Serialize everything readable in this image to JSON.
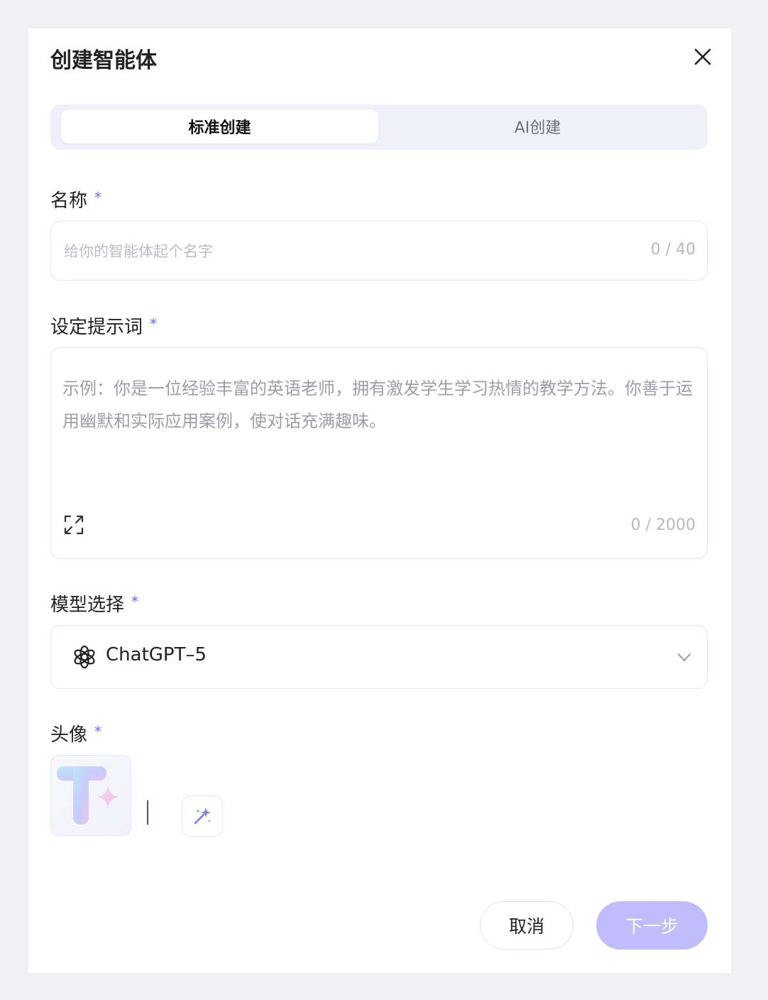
{
  "dialog": {
    "title": "创建智能体",
    "close_icon": "close-icon"
  },
  "tabs": [
    {
      "label": "标准创建",
      "active": true
    },
    {
      "label": "AI创建",
      "active": false
    }
  ],
  "name": {
    "label": "名称",
    "required_mark": "*",
    "placeholder": "给你的智能体起个名字",
    "value": "",
    "counter": "0 / 40"
  },
  "prompt": {
    "label": "设定提示词",
    "required_mark": "*",
    "placeholder": "示例：你是一位经验丰富的英语老师，拥有激发学生学习热情的教学方法。你善于运用幽默和实际应用案例，使对话充满趣味。",
    "value": "",
    "counter": "0 / 2000",
    "expand_icon": "expand-icon"
  },
  "model": {
    "label": "模型选择",
    "required_mark": "*",
    "selected": "ChatGPT–5",
    "icon": "openai-icon",
    "dropdown_icon": "chevron-down-icon"
  },
  "avatar": {
    "label": "头像",
    "required_mark": "*",
    "generate_icon": "magic-wand-icon"
  },
  "footer": {
    "cancel_label": "取消",
    "next_label": "下一步"
  },
  "colors": {
    "accent": "#6f69f2",
    "next_button_disabled": "#c1bcfb",
    "tab_bar_bg": "#eff0f9"
  }
}
